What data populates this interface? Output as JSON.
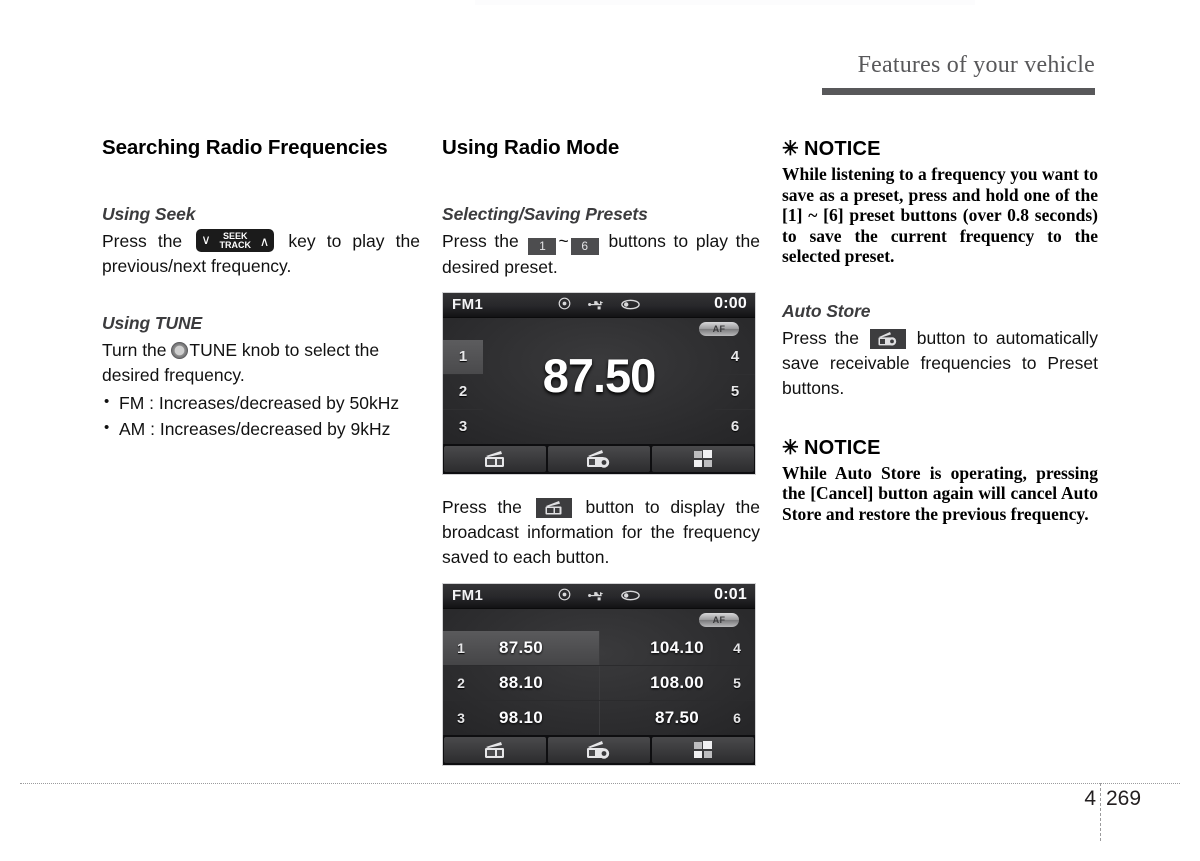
{
  "header": {
    "title": "Features of your vehicle"
  },
  "footer": {
    "chapter": "4",
    "page": "269"
  },
  "left_column": {
    "section_title": "Searching Radio Frequencies",
    "seek": {
      "sub_title": "Using Seek",
      "text_before": "Press the",
      "key_label_top": "SEEK",
      "key_label_bottom": "TRACK",
      "key_chevron_left": "∨",
      "key_chevron_right": "∧",
      "text_after": "key to play the previous/next frequency."
    },
    "tune": {
      "sub_title": "Using TUNE",
      "text_before": "Turn the",
      "knob_label": "TUNE",
      "text_after": "knob to select the desired frequency.",
      "bullets": [
        "FM : Increases/decreased by 50kHz",
        "AM : Increases/decreased by 9kHz"
      ]
    }
  },
  "mid_column": {
    "section_title": "Using Radio Mode",
    "presets": {
      "sub_title": "Selecting/Saving Presets",
      "text_before": "Press the",
      "key_first": "1",
      "tilde": "~",
      "key_last": "6",
      "text_after": "buttons to play the desired preset."
    },
    "info_paragraph": {
      "text_before": "Press the",
      "text_after": "button to display the broadcast information for the frequency saved to each button."
    },
    "display_freq": {
      "band": "FM1",
      "clock": "0:00",
      "af_badge": "AF",
      "frequency": "87.50",
      "presets_left": [
        "1",
        "2",
        "3"
      ],
      "presets_right": [
        "4",
        "5",
        "6"
      ],
      "selected_preset": "1",
      "status_icons": [
        "disc-icon",
        "usb-icon",
        "aux-icon"
      ],
      "toolbar_icons": [
        "radio-info-icon",
        "radio-scan-icon",
        "preset-grid-icon"
      ]
    },
    "display_list": {
      "band": "FM1",
      "clock": "0:01",
      "af_badge": "AF",
      "rows_left": [
        {
          "num": "1",
          "freq": "87.50"
        },
        {
          "num": "2",
          "freq": "88.10"
        },
        {
          "num": "3",
          "freq": "98.10"
        }
      ],
      "rows_right": [
        {
          "num": "4",
          "freq": "104.10"
        },
        {
          "num": "5",
          "freq": "108.00"
        },
        {
          "num": "6",
          "freq": "87.50"
        }
      ],
      "selected_preset": "1",
      "status_icons": [
        "disc-icon",
        "usb-icon",
        "aux-icon"
      ],
      "toolbar_icons": [
        "radio-info-icon",
        "radio-scan-icon",
        "preset-grid-icon"
      ]
    }
  },
  "right_column": {
    "notice_1": {
      "heading": "NOTICE",
      "asterisk": "✳",
      "body": "While listening to a frequency you want to save as a preset, press and hold one of the [1] ~ [6] preset buttons (over 0.8 seconds) to save the current frequency to the selected preset."
    },
    "auto_store": {
      "sub_title": "Auto Store",
      "text_before": "Press the",
      "text_after": "button to automatically save receivable frequencies to Preset buttons."
    },
    "notice_2": {
      "heading": "NOTICE",
      "asterisk": "✳",
      "body": "While Auto Store is operating, pressing the [Cancel] button again will cancel Auto Store and restore the previous frequency."
    }
  },
  "colors": {
    "header_gray": "#58585a",
    "body_black": "#111111",
    "display_dark": "#1d1d1f"
  }
}
